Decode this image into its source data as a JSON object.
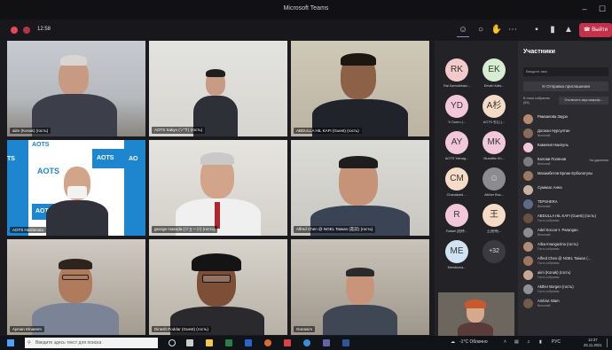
{
  "window": {
    "title": "Microsoft Teams",
    "minimize": "–",
    "maximize": "☐"
  },
  "meeting": {
    "timer": "12:58",
    "leave_label": "Выйти"
  },
  "tiles": [
    {
      "name": "aiim (Konak) (гость)"
    },
    {
      "name": "AOTS Sakyo (ソウ) (гость)"
    },
    {
      "name": "ABDULLA HIL KAFI (Guest) (гость)"
    },
    {
      "name": "AOTS Hashimoto"
    },
    {
      "name": "george masuda (ジョージ) (гость)"
    },
    {
      "name": "Alfred Chen @ NOEL Taiwan (莊誌) (гость)"
    },
    {
      "name": "Ayman Elnaeem"
    },
    {
      "name": "Dinesh Poddar (Guest) (гость)"
    },
    {
      "name": "Gunasim"
    }
  ],
  "backdrop": {
    "logo_text": "AOTS",
    "edge_text_left": "TS",
    "edge_text_right": "AO"
  },
  "rail": [
    {
      "initials": "RK",
      "name": "Rai Kamolbhasi..."
    },
    {
      "initials": "EK",
      "name": "Eevah Kats..."
    },
    {
      "initials": "YD",
      "name": "Yi Duern (..."
    },
    {
      "initials": "A杉",
      "name": "AOTS 杉山 (..."
    },
    {
      "initials": "AY",
      "name": "AOTS Yamag..."
    },
    {
      "initials": "MK",
      "name": "Muzaffar Kh..."
    },
    {
      "initials": "CM",
      "name": "Chanakard ..."
    },
    {
      "initials": "",
      "name": "Akther Bos..."
    },
    {
      "initials": "R",
      "name": "Rafael (招待..."
    },
    {
      "initials": "王",
      "name": "王(招待)..."
    },
    {
      "initials": "ME",
      "name": "Mendezza..."
    },
    {
      "initials": "+32",
      "name": ""
    }
  ],
  "panel": {
    "title": "Участники",
    "search_placeholder": "Введите имя",
    "invite_label": "Отправка приглашения",
    "section_label": "В этом собрании (59)",
    "mute_all": "Отключить звук микроф...",
    "people": [
      {
        "name": "Рамзанова Заура",
        "sub": ""
      },
      {
        "name": "Досжан Нурсултан",
        "sub": "Внешний"
      },
      {
        "name": "Камелия Наилуль",
        "sub": ""
      },
      {
        "name": "Калови Полянов",
        "sub": "Внешний",
        "state": "На удалении"
      },
      {
        "name": "Махамбетов Ерлан Ерболатулы",
        "sub": ""
      },
      {
        "name": "Сумакас Анна",
        "sub": ""
      },
      {
        "name": "TEPSHERA",
        "sub": "Внешний"
      },
      {
        "name": "ABDULLA HIL KAFI (Guest) (гость)",
        "sub": "Гость собрания"
      },
      {
        "name": "Adel Soccor-I. Parangao",
        "sub": "Внешний"
      },
      {
        "name": "Ailsa Imangazina (гость)",
        "sub": "Гость собрания"
      },
      {
        "name": "Alfred Chen @ NOEL Taiwan (...",
        "sub": "Гость собрания"
      },
      {
        "name": "aiim (Konak) (гость)",
        "sub": "Гость собрания"
      },
      {
        "name": "Akther Borgen (гость)",
        "sub": "Гость собрания"
      },
      {
        "name": "Ambrut Islam",
        "sub": "Внешний"
      }
    ]
  },
  "taskbar": {
    "search_placeholder": "Введите здесь текст для поиска",
    "weather": "-1°С Облачно",
    "lang": "РУС",
    "time": "12:37",
    "date": "25.11.2021"
  }
}
